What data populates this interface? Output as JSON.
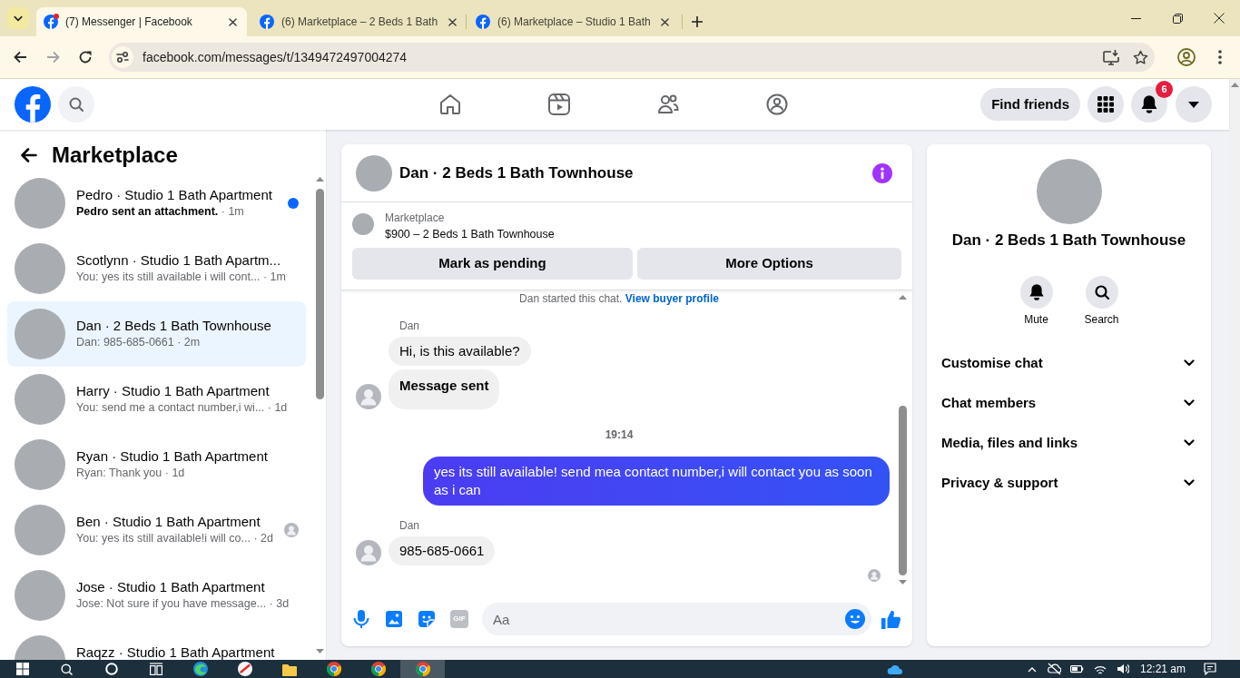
{
  "browser": {
    "tabs": [
      {
        "title": "(7) Messenger | Facebook",
        "selected": true,
        "alert": true
      },
      {
        "title": "(6) Marketplace – 2 Beds 1 Bath",
        "selected": false,
        "alert": false
      },
      {
        "title": "(6) Marketplace – Studio 1 Bath",
        "selected": false,
        "alert": false
      }
    ],
    "url": "facebook.com/messages/t/1349472497004274"
  },
  "header": {
    "find_friends": "Find friends",
    "notifications": "6"
  },
  "sidebar": {
    "title": "Marketplace",
    "conversations": [
      {
        "name": "Pedro · Studio 1 Bath Apartment",
        "preview": "**Pedro sent an attachment.** · 1m",
        "unread": true,
        "seen": false,
        "selected": false
      },
      {
        "name": "Scotlynn · Studio 1 Bath Apartm...",
        "preview": "You: yes its still available i will cont... · 1m",
        "unread": false,
        "seen": false,
        "selected": false
      },
      {
        "name": "Dan · 2 Beds 1 Bath Townhouse",
        "preview": "Dan: 985-685-0661 · 2m",
        "unread": false,
        "seen": false,
        "selected": true
      },
      {
        "name": "Harry · Studio 1 Bath Apartment",
        "preview": "You: send me a contact number,i wi... · 1d",
        "unread": false,
        "seen": false,
        "selected": false
      },
      {
        "name": "Ryan · Studio 1 Bath Apartment",
        "preview": "Ryan: Thank you · 1d",
        "unread": false,
        "seen": false,
        "selected": false
      },
      {
        "name": "Ben · Studio 1 Bath Apartment",
        "preview": "You: yes its still available!i will co... · 2d",
        "unread": false,
        "seen": true,
        "selected": false
      },
      {
        "name": "Jose · Studio 1 Bath Apartment",
        "preview": "Jose: Not sure if you have message... · 3d",
        "unread": false,
        "seen": false,
        "selected": false
      },
      {
        "name": "Raqzz · Studio 1 Bath Apartment",
        "unread": false,
        "seen": false,
        "selected": false
      }
    ]
  },
  "chat": {
    "title": "Dan · 2 Beds 1 Bath Townhouse",
    "listing": {
      "label": "Marketplace",
      "summary": "$900 – 2 Beds 1 Bath Townhouse"
    },
    "actions": [
      "Mark as pending",
      "More Options"
    ],
    "notice": {
      "text": "Dan started this chat.",
      "link": "View buyer profile"
    },
    "messages": [
      {
        "kind": "sender",
        "text": "Dan"
      },
      {
        "kind": "incoming",
        "text": "Hi, is this available?",
        "bold": false,
        "avatar": false
      },
      {
        "kind": "incoming",
        "text": "Message sent",
        "bold": true,
        "avatar": true
      },
      {
        "kind": "time",
        "text": "19:14"
      },
      {
        "kind": "outgoing",
        "text": "yes its still available! send mea contact number,i will contact you as soon as i can"
      },
      {
        "kind": "sender",
        "text": "Dan"
      },
      {
        "kind": "incoming",
        "text": "985-685-0661",
        "bold": false,
        "avatar": true
      }
    ],
    "seen": true,
    "composer": {
      "gif": "GIF",
      "placeholder": "Aa"
    }
  },
  "details": {
    "title": "Dan · 2 Beds 1 Bath Townhouse",
    "actions": [
      {
        "kind": "mute",
        "label": "Mute"
      },
      {
        "kind": "search",
        "label": "Search"
      }
    ],
    "sections": [
      {
        "label": "Customise chat",
        "expanded": false
      },
      {
        "label": "Chat members",
        "expanded": false
      },
      {
        "label": "Media, files and links",
        "expanded": false
      },
      {
        "label": "Privacy & support",
        "expanded": false
      }
    ]
  },
  "taskbar": {
    "items": [
      {
        "kind": "start",
        "active": false
      },
      {
        "kind": "search",
        "active": false
      },
      {
        "kind": "cortana",
        "active": false
      },
      {
        "kind": "task-view",
        "active": false
      },
      {
        "kind": "edge",
        "active": false
      },
      {
        "kind": "app",
        "active": false
      },
      {
        "kind": "files",
        "active": false
      },
      {
        "kind": "chrome",
        "active": false
      },
      {
        "kind": "chrome",
        "active": false
      },
      {
        "kind": "chrome",
        "active": true
      }
    ],
    "clock": "12:21 am"
  }
}
